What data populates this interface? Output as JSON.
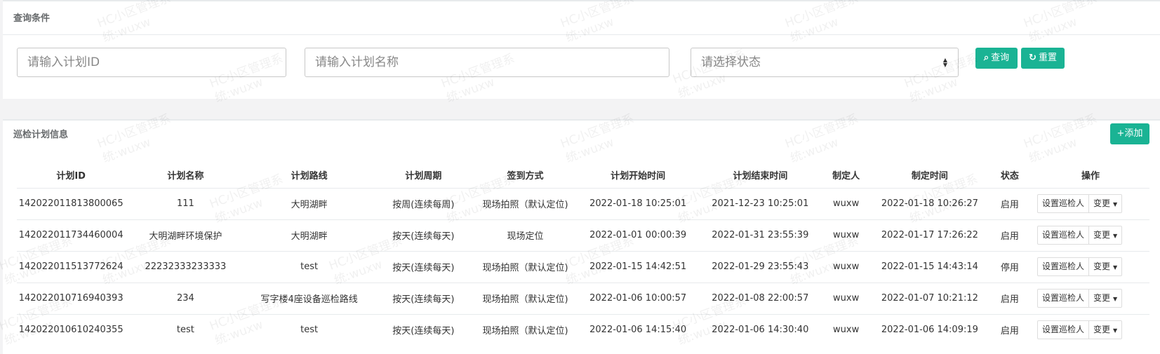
{
  "query": {
    "title": "查询条件",
    "plan_id_placeholder": "请输入计划ID",
    "plan_name_placeholder": "请输入计划名称",
    "state_placeholder": "请选择状态",
    "query_label": "查询",
    "reset_label": "重置",
    "query_icon": "search-icon",
    "reset_icon": "refresh-icon"
  },
  "list": {
    "title": "巡检计划信息",
    "add_label": "+添加",
    "columns": [
      "计划ID",
      "计划名称",
      "计划路线",
      "计划周期",
      "签到方式",
      "计划开始时间",
      "计划结束时间",
      "制定人",
      "制定时间",
      "状态",
      "操作"
    ],
    "rows": [
      {
        "id": "142022011813800065",
        "name": "111",
        "route": "大明湖畔",
        "period": "按周(连续每周)",
        "sign": "现场拍照（默认定位)",
        "start": "2022-01-18 10:25:01",
        "end": "2021-12-23 10:25:01",
        "maker": "wuxw",
        "made": "2022-01-18 10:26:27",
        "state": "启用"
      },
      {
        "id": "142022011734460004",
        "name": "大明湖畔环境保护",
        "route": "大明湖畔",
        "period": "按天(连续每天)",
        "sign": "现场定位",
        "start": "2022-01-01 00:00:39",
        "end": "2022-01-31 23:55:39",
        "maker": "wuxw",
        "made": "2022-01-17 17:26:22",
        "state": "启用"
      },
      {
        "id": "142022011513772624",
        "name": "22232333233333",
        "route": "test",
        "period": "按天(连续每天)",
        "sign": "现场拍照（默认定位)",
        "start": "2022-01-15 14:42:51",
        "end": "2022-01-29 23:55:43",
        "maker": "wuxw",
        "made": "2022-01-15 14:43:14",
        "state": "停用"
      },
      {
        "id": "142022010716940393",
        "name": "234",
        "route": "写字楼4座设备巡检路线",
        "period": "按天(连续每天)",
        "sign": "现场拍照（默认定位)",
        "start": "2022-01-06 10:00:57",
        "end": "2022-01-08 22:00:57",
        "maker": "wuxw",
        "made": "2022-01-07 10:21:12",
        "state": "启用"
      },
      {
        "id": "142022010610240355",
        "name": "test",
        "route": "test",
        "period": "按天(连续每天)",
        "sign": "现场拍照（默认定位)",
        "start": "2022-01-06 14:15:40",
        "end": "2022-01-06 14:30:40",
        "maker": "wuxw",
        "made": "2022-01-06 14:09:19",
        "state": "启用"
      }
    ],
    "set_patrol_label": "设置巡检人",
    "change_label": "变更"
  },
  "watermark": {
    "line1": "HC小区管理系",
    "line2": "统:wuxw"
  },
  "colors": {
    "accent": "#1ab394"
  }
}
